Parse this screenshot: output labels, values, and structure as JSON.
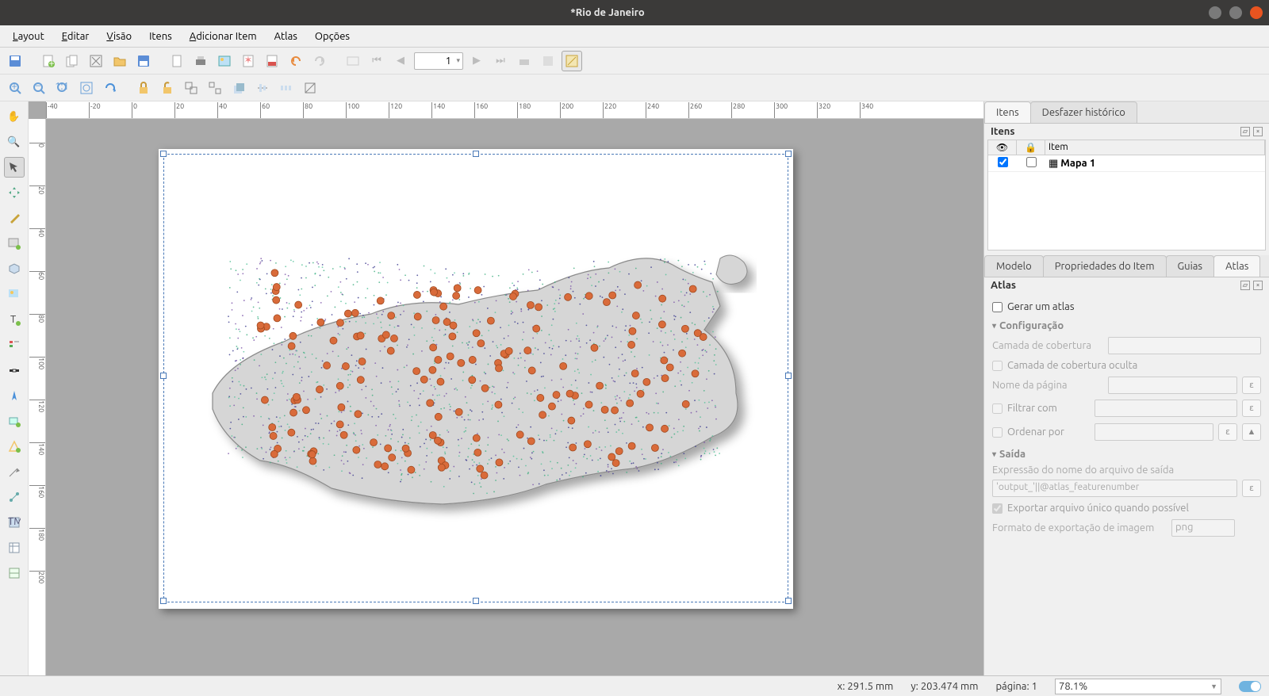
{
  "window": {
    "title": "*Rio de Janeiro"
  },
  "menu": {
    "layout": "Layout",
    "editar": "Editar",
    "visao": "Visão",
    "itens": "Itens",
    "adicionar": "Adicionar Item",
    "atlas": "Atlas",
    "opcoes": "Opções"
  },
  "nav": {
    "page_current": "1"
  },
  "panel_items": {
    "tab_items": "Itens",
    "tab_undo": "Desfazer histórico",
    "title": "Itens",
    "col_item": "Item",
    "row1_name": "Mapa 1"
  },
  "panel_props": {
    "tab_modelo": "Modelo",
    "tab_props": "Propriedades do Item",
    "tab_guias": "Guias",
    "tab_atlas": "Atlas",
    "title": "Atlas",
    "gen": "Gerar um atlas",
    "grp_config": "Configuração",
    "coverage": "Camada de cobertura",
    "coverage_hidden": "Camada de cobertura oculta",
    "page_name": "Nome da página",
    "filter": "Filtrar com",
    "sort": "Ordenar por",
    "grp_output": "Saída",
    "out_expr_label": "Expressão do nome do arquivo de saída",
    "out_expr_value": "'output_'||@atlas_featurenumber",
    "single": "Exportar arquivo único quando possível",
    "fmt": "Formato de exportação de imagem",
    "fmt_val": "png"
  },
  "status": {
    "x": "x: 291.5 mm",
    "y": "y: 203.474 mm",
    "page": "página: 1",
    "zoom": "78.1%"
  },
  "ruler_h": [
    "-40",
    "-20",
    "0",
    "20",
    "40",
    "60",
    "80",
    "100",
    "120",
    "140",
    "160",
    "180",
    "200",
    "220",
    "240",
    "260",
    "280",
    "300",
    "320",
    "340"
  ],
  "ruler_v": [
    "0",
    "20",
    "40",
    "60",
    "80",
    "100",
    "120",
    "140",
    "160",
    "180",
    "200"
  ]
}
